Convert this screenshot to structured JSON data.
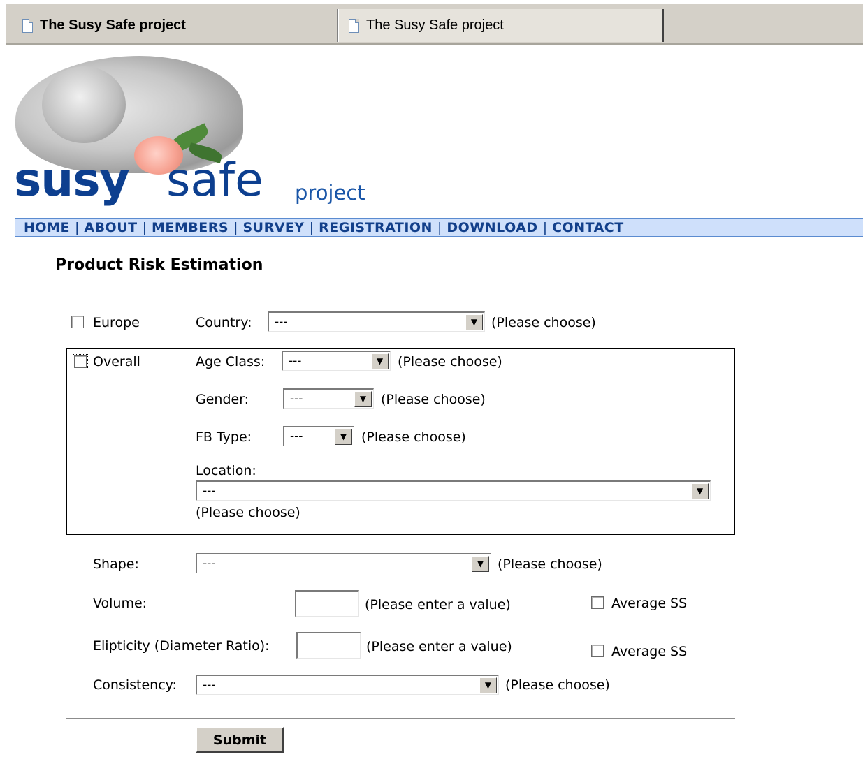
{
  "browser": {
    "tabs": [
      {
        "label": "The Susy Safe project",
        "active": true
      },
      {
        "label": "The Susy Safe project",
        "active": false
      }
    ]
  },
  "header": {
    "logo": {
      "word1": "susy",
      "word2": "safe",
      "word3": "project"
    }
  },
  "nav": {
    "items": [
      "HOME",
      "ABOUT",
      "MEMBERS",
      "SURVEY",
      "REGISTRATION",
      "DOWNLOAD",
      "CONTACT"
    ],
    "separator": "|"
  },
  "page": {
    "title": "Product Risk Estimation"
  },
  "form": {
    "europe": {
      "label": "Europe",
      "checked": false
    },
    "country": {
      "label": "Country:",
      "value": "---",
      "hint": "(Please choose)"
    },
    "overall": {
      "label": "Overall",
      "checked": false
    },
    "age_class": {
      "label": "Age Class:",
      "value": "---",
      "hint": "(Please choose)"
    },
    "gender": {
      "label": "Gender:",
      "value": "---",
      "hint": "(Please choose)"
    },
    "fb_type": {
      "label": "FB Type:",
      "value": "---",
      "hint": "(Please choose)"
    },
    "location": {
      "label": "Location:",
      "value": "---",
      "hint": "(Please choose)"
    },
    "shape": {
      "label": "Shape:",
      "value": "---",
      "hint": "(Please choose)"
    },
    "volume": {
      "label": "Volume:",
      "value": "",
      "hint": "(Please enter a value)",
      "avg_label": "Average SS"
    },
    "ellipticity": {
      "label": "Elipticity (Diameter Ratio):",
      "value": "",
      "hint": "(Please enter a value)",
      "avg_label": "Average SS"
    },
    "consistency": {
      "label": "Consistency:",
      "value": "---",
      "hint": "(Please choose)"
    },
    "submit_label": "Submit"
  },
  "colors": {
    "brand_blue": "#0d3f8f",
    "nav_bg": "#cfe0fb",
    "chrome_gray": "#d4d0c8"
  }
}
